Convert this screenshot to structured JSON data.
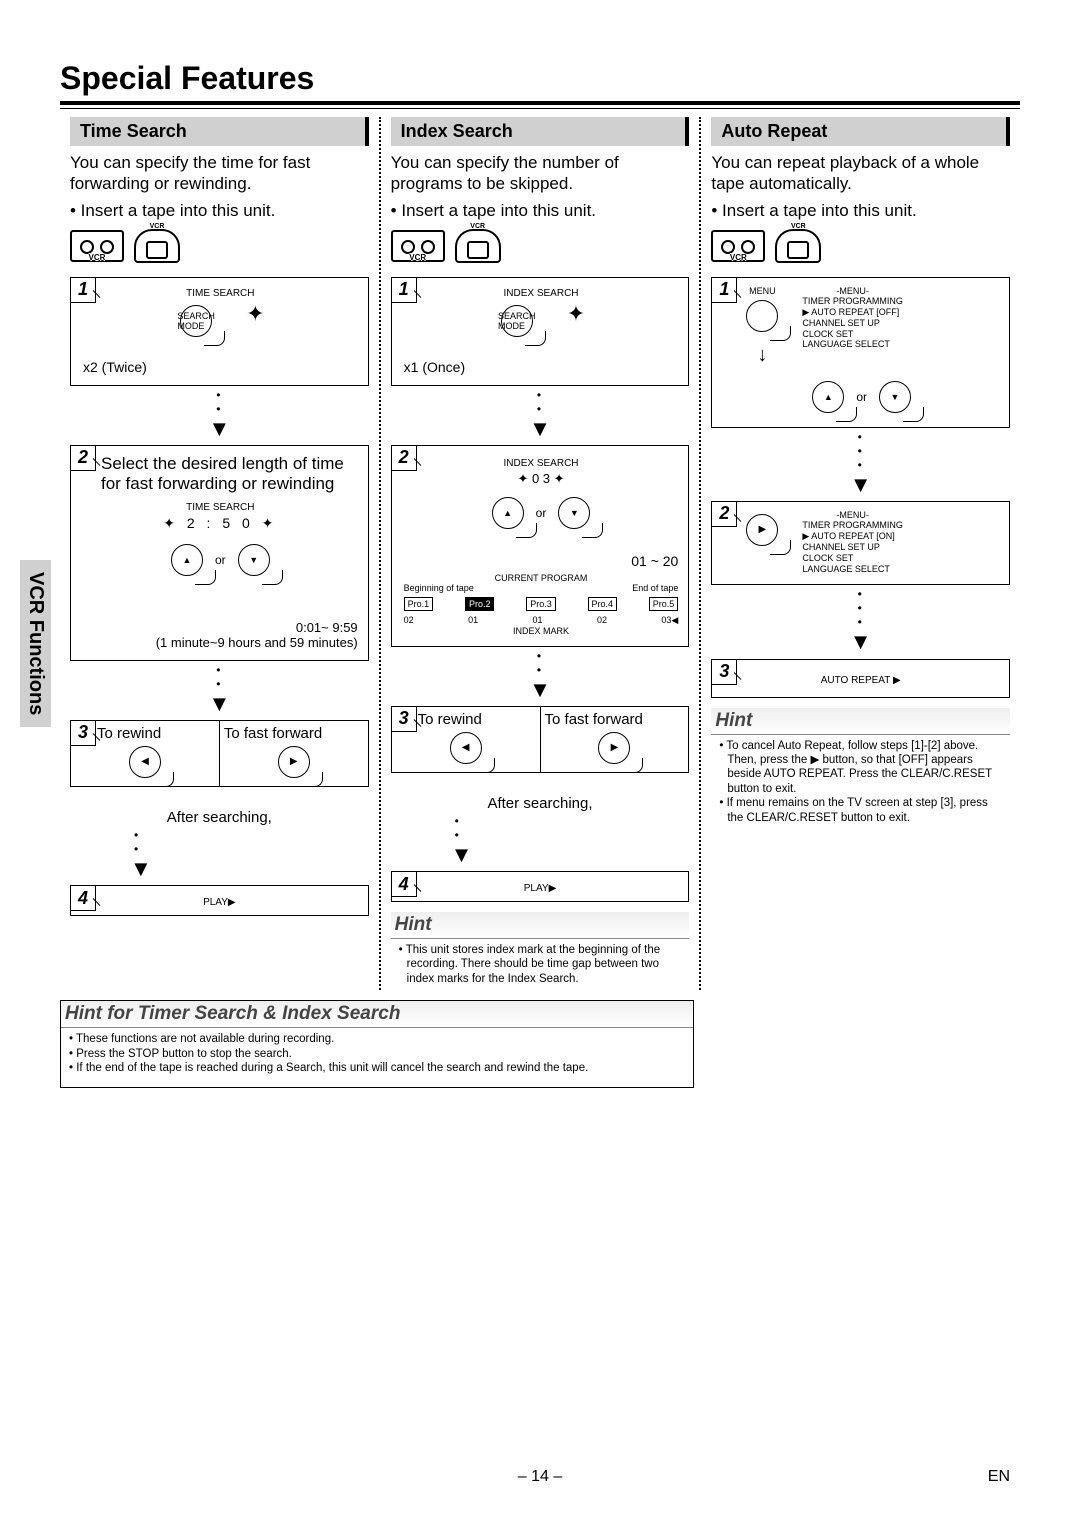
{
  "page": {
    "title": "Special Features",
    "side_tab": "VCR Functions",
    "page_number": "– 14 –",
    "lang": "EN"
  },
  "col1": {
    "header": "Time Search",
    "intro": "You can specify the time for fast forwarding or rewinding.",
    "bullet": "• Insert a tape into this unit.",
    "step1": {
      "label": "TIME SEARCH",
      "note": "x2 (Twice)",
      "btn": "SEARCH MODE"
    },
    "step2": {
      "text": "Select the desired length of time for fast forwarding or rewinding",
      "label": "TIME SEARCH",
      "display": "2 : 5 0",
      "or": "or",
      "range": "0:01~ 9:59",
      "range2": "(1 minute~9 hours and 59 minutes)"
    },
    "step3": {
      "left": "To rewind",
      "right": "To fast forward",
      "after": "After searching,"
    },
    "step4": {
      "label": "PLAY▶"
    }
  },
  "col2": {
    "header": "Index Search",
    "intro": "You can specify the number of programs to be skipped.",
    "bullet": "• Insert a tape into this unit.",
    "step1": {
      "label": "INDEX SEARCH",
      "note": "x1 (Once)",
      "btn": "SEARCH MODE"
    },
    "step2": {
      "label": "INDEX SEARCH",
      "display": "0 3",
      "or": "or",
      "range": "01 ~ 20",
      "curprog": "CURRENT PROGRAM",
      "begin": "Beginning of tape",
      "end": "End of tape",
      "progs": [
        "Pro.1",
        "Pro.2",
        "Pro.3",
        "Pro.4",
        "Pro.5"
      ],
      "nums": [
        "02",
        "01",
        "01",
        "02",
        "03◀"
      ],
      "indexmark": "INDEX MARK"
    },
    "step3": {
      "left": "To rewind",
      "right": "To fast forward",
      "after": "After searching,"
    },
    "step4": {
      "label": "PLAY▶"
    },
    "hint_title": "Hint",
    "hint_body": "This unit stores index mark at the beginning of the recording. There should be time gap between two index marks for the Index Search."
  },
  "col3": {
    "header": "Auto Repeat",
    "intro": "You can repeat playback of a whole tape automatically.",
    "bullet": "• Insert a tape into this unit.",
    "step1": {
      "btn": "MENU",
      "menu_title": "-MENU-",
      "menu_items": [
        "TIMER PROGRAMMING",
        "▶ AUTO REPEAT  [OFF]",
        "CHANNEL SET UP",
        "CLOCK SET",
        "LANGUAGE SELECT"
      ],
      "or": "or"
    },
    "step2": {
      "menu_title": "-MENU-",
      "menu_items": [
        "TIMER PROGRAMMING",
        "▶ AUTO REPEAT  [ON]",
        "CHANNEL SET UP",
        "CLOCK SET",
        "LANGUAGE SELECT"
      ]
    },
    "step3": {
      "label": "AUTO REPEAT ▶"
    },
    "hint_title": "Hint",
    "hint_items": [
      "To cancel Auto Repeat, follow steps [1]-[2] above. Then, press the ▶ button, so that [OFF] appears beside AUTO REPEAT.  Press the CLEAR/C.RESET button to exit.",
      "If menu remains on the TV screen at step [3], press the CLEAR/C.RESET button to exit."
    ]
  },
  "bottom_hint": {
    "title": "Hint for Timer Search & Index Search",
    "items": [
      "These functions are not available during recording.",
      "Press the STOP button to stop the search.",
      "If the end of the tape is reached during a Search, this unit will cancel the search and rewind the tape."
    ]
  }
}
